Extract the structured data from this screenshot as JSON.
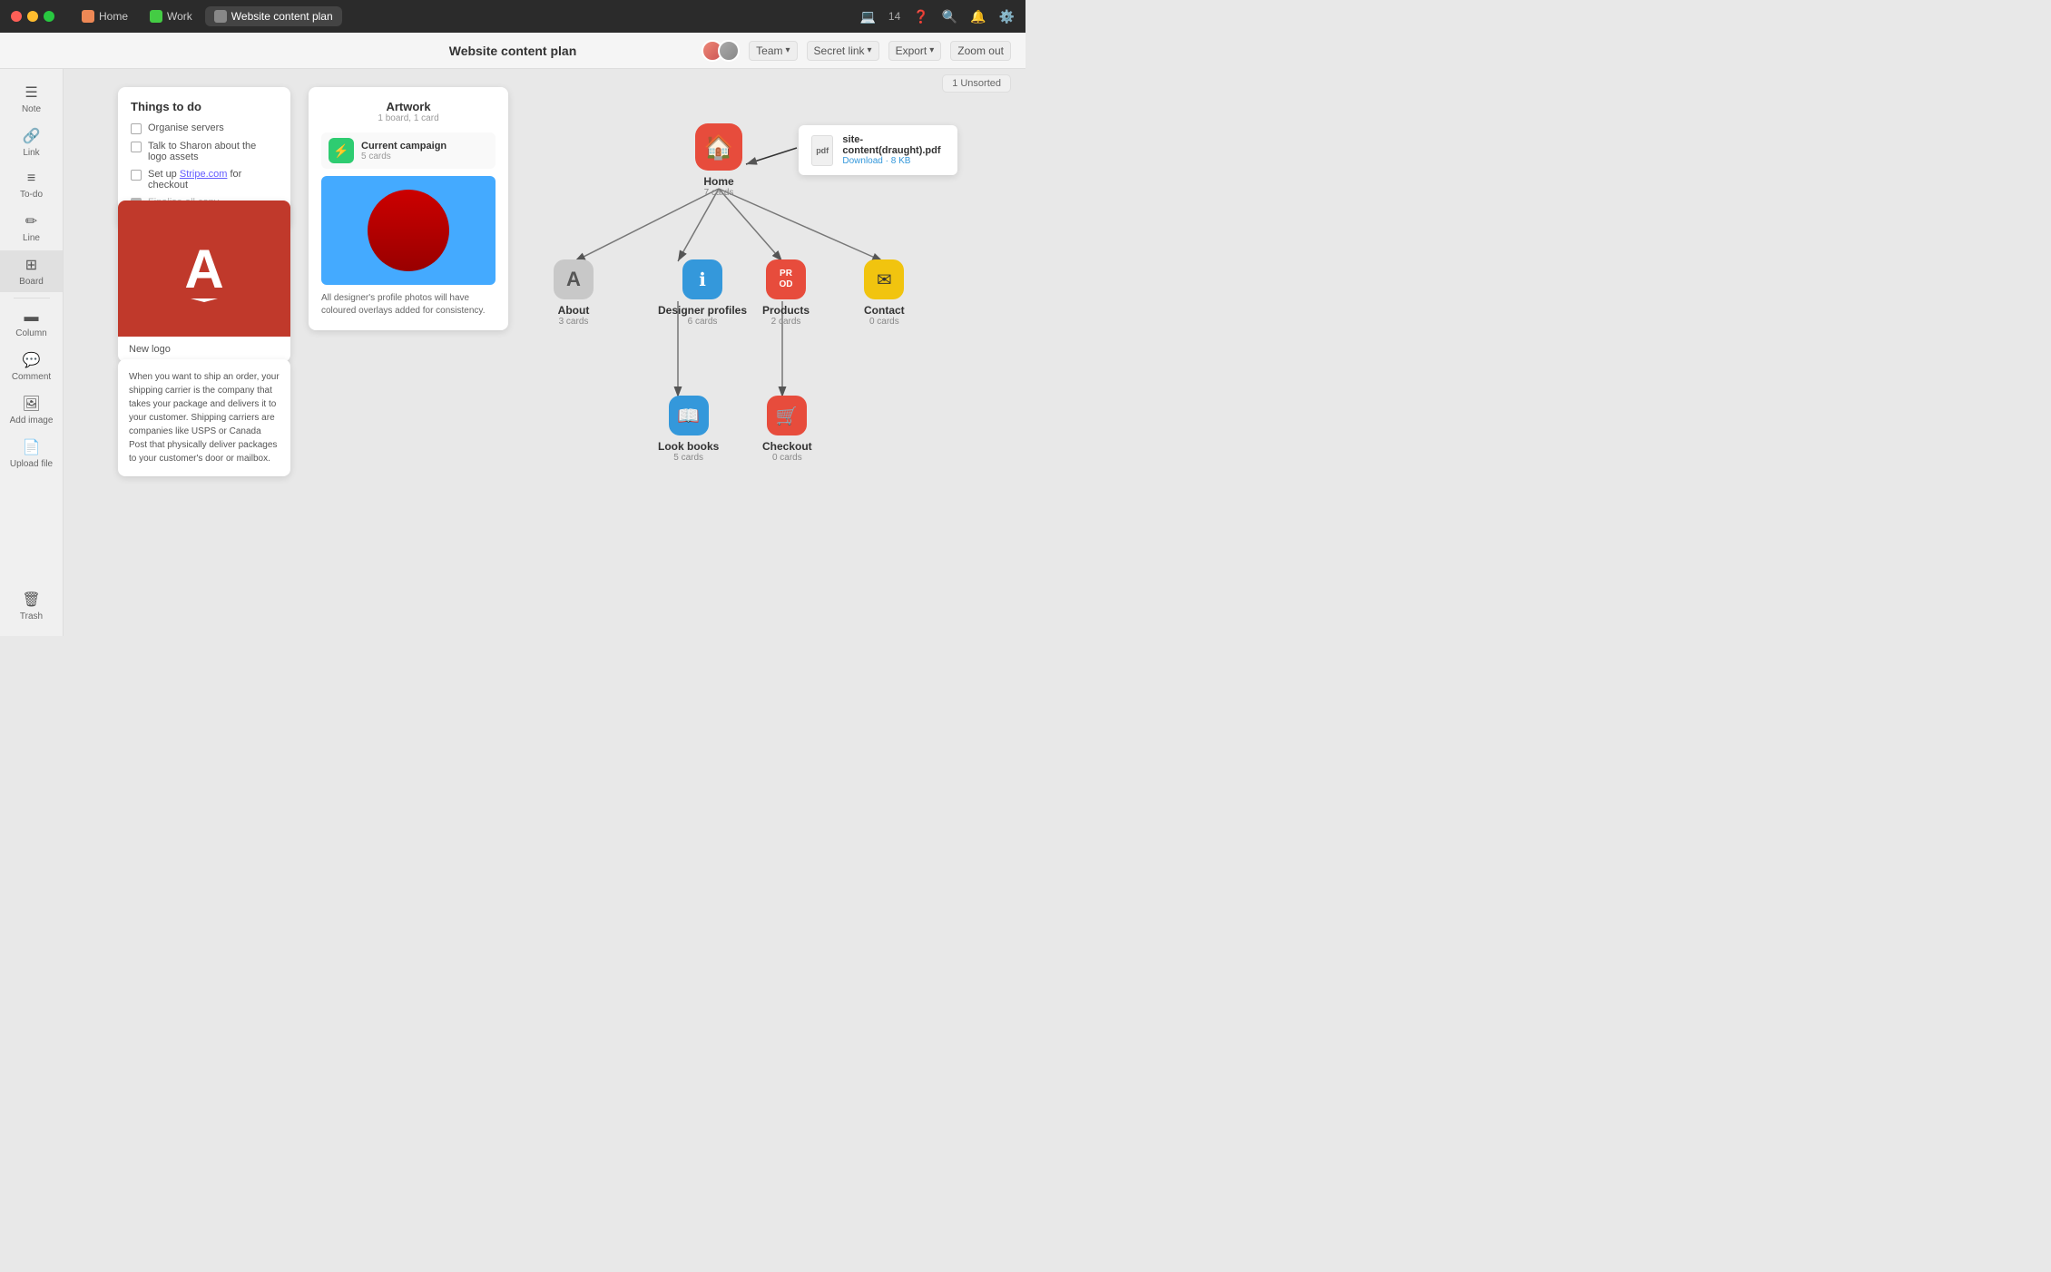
{
  "titlebar": {
    "tabs": [
      {
        "label": "Home",
        "icon_type": "home",
        "active": false
      },
      {
        "label": "Work",
        "icon_type": "work",
        "active": false
      },
      {
        "label": "Website content plan",
        "icon_type": "ws",
        "active": true
      }
    ],
    "right": {
      "device_icon": "💻",
      "count": "14",
      "help_icon": "?",
      "search_icon": "🔍",
      "bell_icon": "🔔",
      "gear_icon": "⚙"
    }
  },
  "menubar": {
    "title": "Website content plan",
    "team_label": "Team",
    "secret_link_label": "Secret link",
    "export_label": "Export",
    "zoom_out_label": "Zoom out",
    "unsorted_label": "1 Unsorted"
  },
  "sidebar": {
    "items": [
      {
        "icon": "☰",
        "label": "Note"
      },
      {
        "icon": "🔗",
        "label": "Link"
      },
      {
        "icon": "☰",
        "label": "To-do"
      },
      {
        "icon": "✏️",
        "label": "Line"
      },
      {
        "icon": "⊞",
        "label": "Board",
        "active": true
      },
      {
        "icon": "▬",
        "label": "Column"
      },
      {
        "icon": "💬",
        "label": "Comment"
      },
      {
        "icon": "🖼",
        "label": "Add image"
      },
      {
        "icon": "📄",
        "label": "Upload file"
      }
    ],
    "trash_label": "Trash"
  },
  "todo_card": {
    "title": "Things to do",
    "items": [
      {
        "text": "Organise servers",
        "checked": false
      },
      {
        "text": "Talk to Sharon about the logo assets",
        "checked": false
      },
      {
        "text": "Set up Stripe.com for checkout",
        "checked": false,
        "has_link": true,
        "link_text": "Stripe.com"
      },
      {
        "text": "Finalise all copy",
        "checked": true
      }
    ]
  },
  "artwork_card": {
    "title": "Artwork",
    "subtitle": "1 board, 1 card",
    "campaign": {
      "name": "Current campaign",
      "count": "5 cards"
    },
    "description": "All designer's profile photos will have coloured overlays added for consistency."
  },
  "logo_card": {
    "label": "New logo",
    "letter": "A"
  },
  "text_card": {
    "content": "When you want to ship an order, your shipping carrier is the company that takes your package and delivers it to your customer. Shipping carriers are companies like USPS or Canada Post that physically deliver packages to your customer's door or mailbox."
  },
  "pdf_card": {
    "icon_label": "pdf",
    "name": "site-content(draught).pdf",
    "download_text": "Download · 8 KB"
  },
  "mindmap": {
    "home": {
      "label": "Home",
      "count": "7 cards"
    },
    "about": {
      "label": "About",
      "count": "3 cards"
    },
    "designer": {
      "label": "Designer profiles",
      "count": "6 cards"
    },
    "products": {
      "label": "Products",
      "count": "2 cards",
      "text": "PR\nOD"
    },
    "contact": {
      "label": "Contact",
      "count": "0 cards"
    },
    "lookbooks": {
      "label": "Look books",
      "count": "5 cards"
    },
    "checkout": {
      "label": "Checkout",
      "count": "0 cards"
    }
  },
  "icons": {
    "home_symbol": "🏠",
    "about_symbol": "A",
    "designer_symbol": "ℹ",
    "contact_symbol": "✉",
    "lookbooks_symbol": "📖",
    "checkout_symbol": "🛒"
  }
}
